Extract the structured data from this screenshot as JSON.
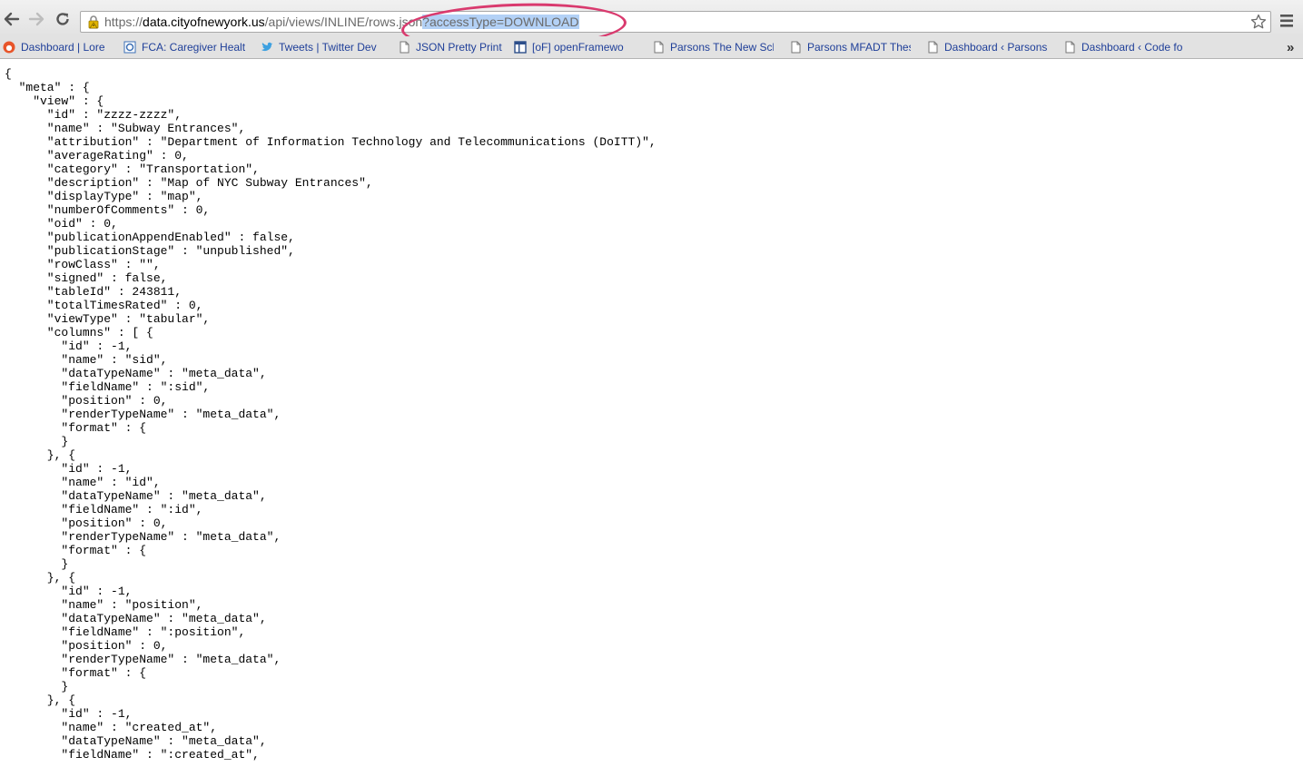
{
  "browser": {
    "url": {
      "host_prefix": "https://",
      "host": "data.cityofnewyork.us",
      "path": "/api/views/INLINE/rows.json",
      "query_selected": "?accessType=DOWNLOAD"
    },
    "icons": {
      "back": "arrow-left-icon",
      "forward": "arrow-right-icon",
      "reload": "reload-icon",
      "lock": "warning-lock-icon",
      "star": "star-icon",
      "menu": "hamburger-menu-icon"
    },
    "annotation_color": "#d93a6e"
  },
  "bookmarks": [
    {
      "label": "Dashboard | Lore",
      "icon": "lore-icon"
    },
    {
      "label": "FCA: Caregiver Healt",
      "icon": "fca-icon"
    },
    {
      "label": "Tweets | Twitter Dev",
      "icon": "twitter-icon"
    },
    {
      "label": "JSON Pretty Print",
      "icon": "page-icon"
    },
    {
      "label": "[oF] openFramewo",
      "icon": "of-icon"
    },
    {
      "label": "Parsons The New Sch",
      "icon": "page-icon"
    },
    {
      "label": "Parsons MFADT Thes",
      "icon": "page-icon"
    },
    {
      "label": "Dashboard ‹ Parsons",
      "icon": "page-icon"
    },
    {
      "label": "Dashboard ‹ Code fo",
      "icon": "page-icon"
    }
  ],
  "json_lines": [
    "{",
    "  \"meta\" : {",
    "    \"view\" : {",
    "      \"id\" : \"zzzz-zzzz\",",
    "      \"name\" : \"Subway Entrances\",",
    "      \"attribution\" : \"Department of Information Technology and Telecommunications (DoITT)\",",
    "      \"averageRating\" : 0,",
    "      \"category\" : \"Transportation\",",
    "      \"description\" : \"Map of NYC Subway Entrances\",",
    "      \"displayType\" : \"map\",",
    "      \"numberOfComments\" : 0,",
    "      \"oid\" : 0,",
    "      \"publicationAppendEnabled\" : false,",
    "      \"publicationStage\" : \"unpublished\",",
    "      \"rowClass\" : \"\",",
    "      \"signed\" : false,",
    "      \"tableId\" : 243811,",
    "      \"totalTimesRated\" : 0,",
    "      \"viewType\" : \"tabular\",",
    "      \"columns\" : [ {",
    "        \"id\" : -1,",
    "        \"name\" : \"sid\",",
    "        \"dataTypeName\" : \"meta_data\",",
    "        \"fieldName\" : \":sid\",",
    "        \"position\" : 0,",
    "        \"renderTypeName\" : \"meta_data\",",
    "        \"format\" : {",
    "        }",
    "      }, {",
    "        \"id\" : -1,",
    "        \"name\" : \"id\",",
    "        \"dataTypeName\" : \"meta_data\",",
    "        \"fieldName\" : \":id\",",
    "        \"position\" : 0,",
    "        \"renderTypeName\" : \"meta_data\",",
    "        \"format\" : {",
    "        }",
    "      }, {",
    "        \"id\" : -1,",
    "        \"name\" : \"position\",",
    "        \"dataTypeName\" : \"meta_data\",",
    "        \"fieldName\" : \":position\",",
    "        \"position\" : 0,",
    "        \"renderTypeName\" : \"meta_data\",",
    "        \"format\" : {",
    "        }",
    "      }, {",
    "        \"id\" : -1,",
    "        \"name\" : \"created_at\",",
    "        \"dataTypeName\" : \"meta_data\",",
    "        \"fieldName\" : \":created_at\","
  ]
}
